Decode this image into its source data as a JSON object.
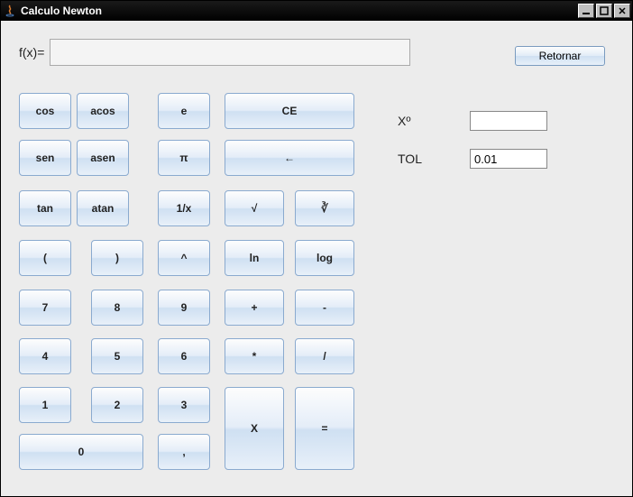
{
  "window": {
    "title": "Calculo Newton"
  },
  "form": {
    "fx_label": "f(x)=",
    "fx_value": "",
    "retornar": "Retornar",
    "x0_label": "Xº",
    "x0_value": "",
    "tol_label": "TOL",
    "tol_value": "0.01"
  },
  "buttons": {
    "cos": "cos",
    "acos": "acos",
    "e": "e",
    "ce": "CE",
    "sen": "sen",
    "asen": "asen",
    "pi": "π",
    "back": "←",
    "tan": "tan",
    "atan": "atan",
    "inv": "1/x",
    "sqrt": "√",
    "cbrt": "∛",
    "lparen": "(",
    "rparen": ")",
    "pow": "^",
    "ln": "ln",
    "log": "log",
    "n7": "7",
    "n8": "8",
    "n9": "9",
    "plus": "+",
    "minus": "-",
    "n4": "4",
    "n5": "5",
    "n6": "6",
    "mul": "*",
    "div": "/",
    "n1": "1",
    "n2": "2",
    "n3": "3",
    "varx": "X",
    "eq": "=",
    "n0": "0",
    "comma": ","
  }
}
